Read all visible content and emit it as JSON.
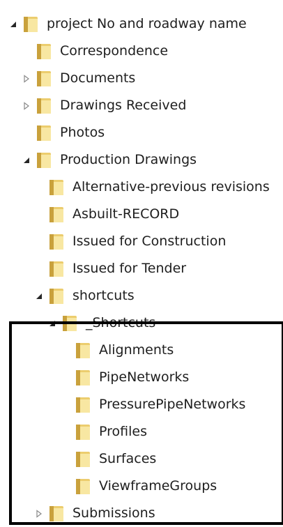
{
  "tree": {
    "root": {
      "label": "project No and roadway name",
      "expanded": true
    },
    "items": [
      {
        "label": "Correspondence"
      },
      {
        "label": "Documents",
        "collapsed": true
      },
      {
        "label": "Drawings Received",
        "collapsed": true
      },
      {
        "label": "Photos"
      },
      {
        "label": "Production Drawings",
        "expanded": true
      },
      {
        "label": "Alternative-previous revisions"
      },
      {
        "label": "Asbuilt-RECORD"
      },
      {
        "label": "Issued for Construction"
      },
      {
        "label": "Issued for Tender"
      },
      {
        "label": "shortcuts",
        "expanded": true
      },
      {
        "label": "_Shortcuts",
        "expanded": true
      },
      {
        "label": "Alignments"
      },
      {
        "label": "PipeNetworks"
      },
      {
        "label": "PressurePipeNetworks"
      },
      {
        "label": "Profiles"
      },
      {
        "label": "Surfaces"
      },
      {
        "label": "ViewframeGroups"
      },
      {
        "label": "Submissions",
        "collapsed": true
      }
    ]
  },
  "icons": {
    "expanded": "triangle-expanded-icon",
    "collapsed": "triangle-collapsed-icon",
    "folder": "folder-icon"
  },
  "colors": {
    "folder_light": "#f8e7a2",
    "folder_mid": "#eccd6e",
    "folder_dark": "#c9a13c",
    "highlight_border": "#000000",
    "text": "#1e1e1e"
  }
}
